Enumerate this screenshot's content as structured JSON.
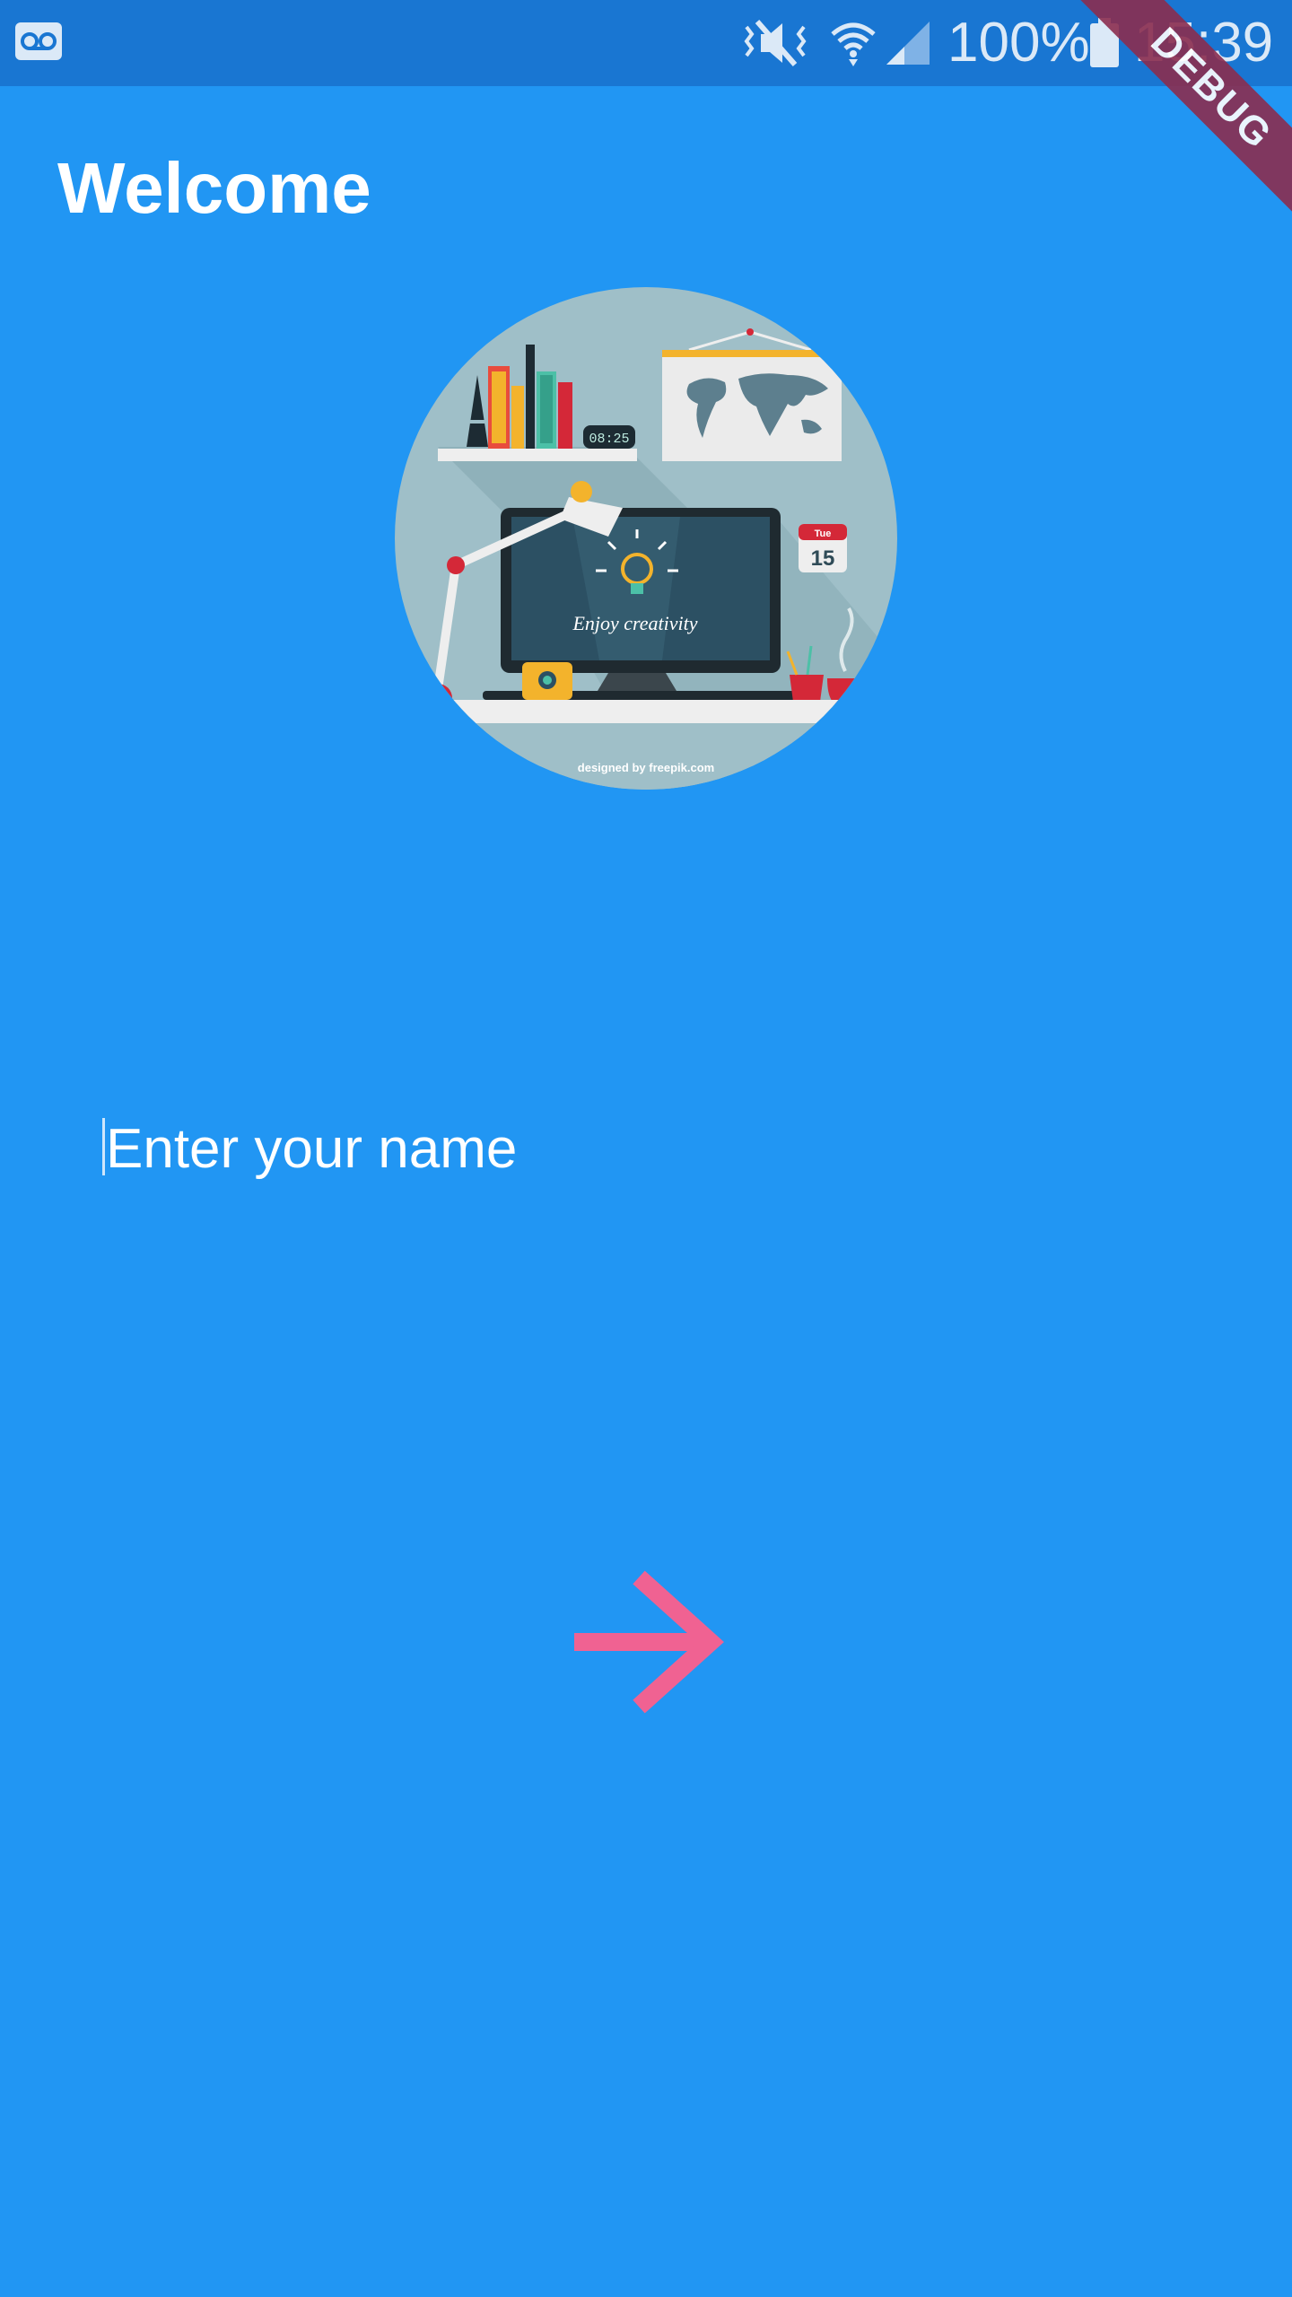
{
  "status_bar": {
    "left_icon": "voicemail-icon",
    "icons": [
      "vibrate-mute-icon",
      "wifi-icon",
      "signal-icon",
      "battery-icon"
    ],
    "battery_text": "100%",
    "time": "15:39"
  },
  "debug_banner": {
    "label": "DEBUG"
  },
  "welcome": {
    "title": "Welcome"
  },
  "hero_image": {
    "illustration": "desk-workspace-illustration",
    "clock_text": "08:25",
    "calendar_day": "Tue",
    "calendar_date": "15",
    "screen_text": "Enjoy creativity",
    "credit_text": "designed by freepik.com"
  },
  "name_input": {
    "value": "",
    "placeholder": "Enter your name"
  },
  "next_button": {
    "icon": "arrow-right-icon"
  },
  "colors": {
    "background": "#2196F3",
    "status_bar": "#1976D2",
    "accent": "#F06292",
    "debug_banner": "#8B2D4F"
  }
}
